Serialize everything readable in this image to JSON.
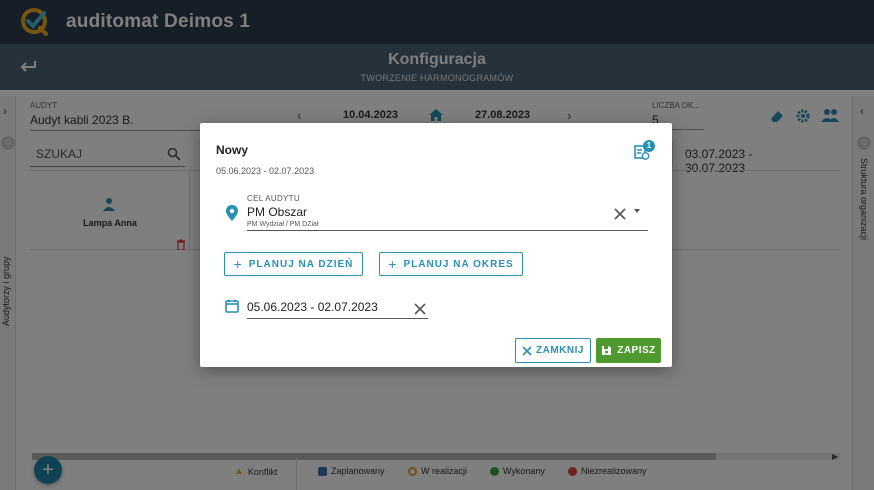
{
  "header": {
    "app_title": "auditomat Deimos 1",
    "page_title": "Konfiguracja",
    "page_subtitle": "TWORZENIE HARMONOGRAMÓW"
  },
  "toolbar": {
    "audit_caption": "AUDYT",
    "audit_value": "Audyt kabli 2023 B.",
    "date_start": "10.04.2023",
    "date_end": "27.08.2023",
    "count_caption": "LICZBA OK...",
    "count_value": "5"
  },
  "left_panel": {
    "label": "Audytorzy i grupy",
    "badge": "0",
    "search_placeholder": "SZUKAJ"
  },
  "right_panel": {
    "label": "Struktura organizacji",
    "badge": "0"
  },
  "grid": {
    "range_header": "03.07.2023 - 30.07.2023",
    "auditor_name": "Lampa Anna"
  },
  "legend": {
    "conflict": "Konflikt",
    "planned": "Zaplanowany",
    "in_progress": "W realizacji",
    "done": "Wykonany",
    "not_done": "Niezrealizowany"
  },
  "fab": {
    "label": "+"
  },
  "modal": {
    "title": "Nowy",
    "range": "05.06.2023 - 02.07.2023",
    "badge_count": "1",
    "target_caption": "CEL AUDYTU",
    "target_value": "PM Obszar",
    "target_hint": "PM Wydział / PM DZiał",
    "plan_day_label": "PLANUJ NA DZIEŃ",
    "plan_period_label": "PLANUJ NA OKRES",
    "date_value": "05.06.2023 - 02.07.2023",
    "close_label": "ZAMKNIJ",
    "save_label": "ZAPISZ"
  },
  "colors": {
    "topbar": "#2c3e50",
    "subbar": "#4a6477",
    "accent": "#2a8fb5",
    "save": "#4e9a2e"
  }
}
